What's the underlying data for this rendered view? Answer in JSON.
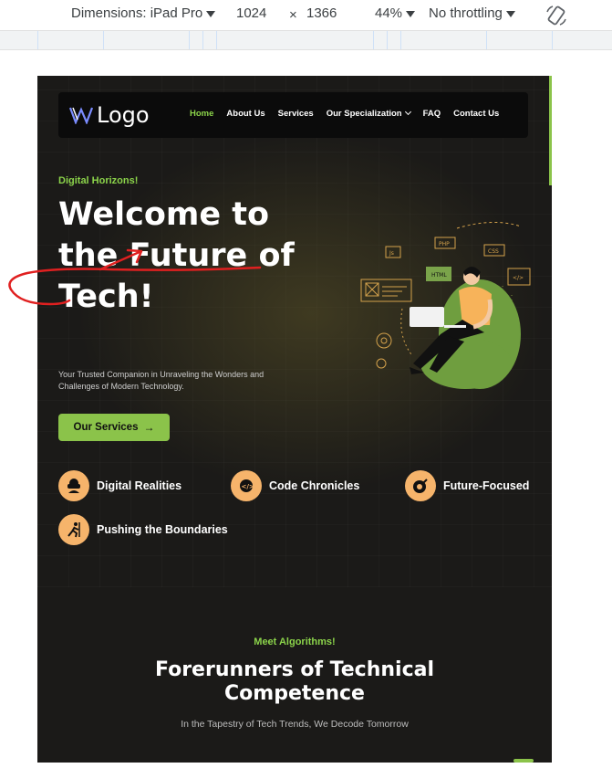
{
  "devtools": {
    "dimensions_label": "Dimensions: iPad Pro",
    "width": "1024",
    "times": "×",
    "height": "1366",
    "zoom": "44%",
    "throttling": "No throttling",
    "rotate_icon": "rotate-icon"
  },
  "site": {
    "logo_text": "Logo",
    "nav": [
      "Home",
      "About Us",
      "Services",
      "Our Specialization",
      "FAQ",
      "Contact Us"
    ],
    "colors": {
      "accent": "#8bc34a",
      "background": "#1b1a18",
      "icon_circle": "#f6b46b"
    },
    "hero": {
      "eyebrow": "Digital Horizons!",
      "title": "Welcome to the Future of Tech!",
      "subtitle": "Your Trusted Companion in Unraveling the Wonders and Challenges of Modern Technology.",
      "cta": "Our Services"
    },
    "features": [
      "Digital Realities",
      "Code Chronicles",
      "Future-Focused",
      "Pushing the Boundaries"
    ],
    "section": {
      "eyebrow": "Meet Algorithms!",
      "title": "Forerunners of Technical Competence",
      "subtitle": "In the Tapestry of Tech Trends, We Decode Tomorrow"
    },
    "illustration_labels": {
      "js": "Js",
      "php": "PHP",
      "css": "CSS",
      "html": "HTML"
    }
  }
}
